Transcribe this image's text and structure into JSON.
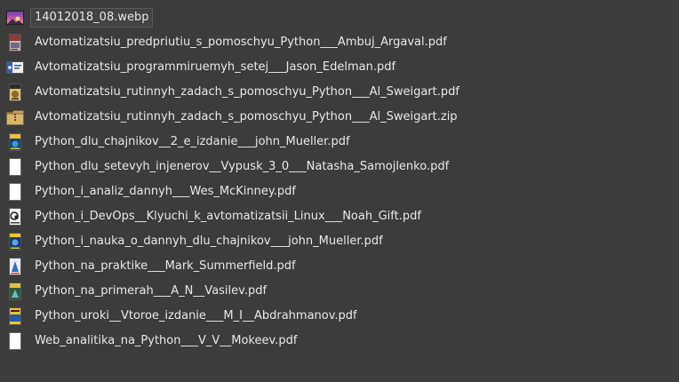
{
  "files": [
    {
      "name": "14012018_08.webp",
      "icon": "image-thumbnail-icon",
      "selected": true
    },
    {
      "name": "Avtomatizatsiu_predpriutiu_s_pomoschyu_Python___Ambuj_Argaval.pdf",
      "icon": "pdf-thumbnail-icon"
    },
    {
      "name": "Avtomatizatsiu_programmiruemyh_setej___Jason_Edelman.pdf",
      "icon": "pdf-thumbnail-icon"
    },
    {
      "name": "Avtomatizatsiu_rutinnyh_zadach_s_pomoschyu_Python___Al_Sweigart.pdf",
      "icon": "pdf-thumbnail-icon"
    },
    {
      "name": "Avtomatizatsiu_rutinnyh_zadach_s_pomoschyu_Python___Al_Sweigart.zip",
      "icon": "archive-icon"
    },
    {
      "name": "Python_dlu_chajnikov__2_e_izdanie___john_Mueller.pdf",
      "icon": "pdf-thumbnail-icon"
    },
    {
      "name": "Python_dlu_setevyh_injenerov__Vypusk_3_0___Natasha_Samojlenko.pdf",
      "icon": "blank-document-icon"
    },
    {
      "name": "Python_i_analiz_dannyh___Wes_McKinney.pdf",
      "icon": "blank-document-icon"
    },
    {
      "name": "Python_i_DevOps__Klyuchi_k_avtomatizatsii_Linux___Noah_Gift.pdf",
      "icon": "pdf-thumbnail-icon"
    },
    {
      "name": "Python_i_nauka_o_dannyh_dlu_chajnikov___john_Mueller.pdf",
      "icon": "pdf-thumbnail-icon"
    },
    {
      "name": "Python_na_praktike___Mark_Summerfield.pdf",
      "icon": "pdf-thumbnail-icon"
    },
    {
      "name": "Python_na_primerah___A_N__Vasilev.pdf",
      "icon": "pdf-thumbnail-icon"
    },
    {
      "name": "Python_uroki__Vtoroe_izdanie___M_I__Abdrahmanov.pdf",
      "icon": "pdf-thumbnail-icon"
    },
    {
      "name": "Web_analitika_na_Python___V_V__Mokeev.pdf",
      "icon": "blank-document-icon"
    }
  ]
}
